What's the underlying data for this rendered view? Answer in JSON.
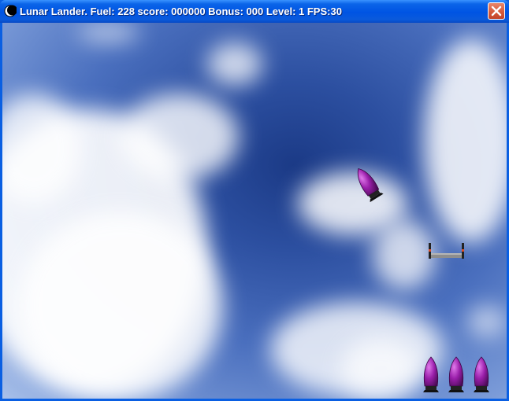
{
  "window": {
    "title": "Lunar Lander. Fuel: 228 score: 000000 Bonus: 000 Level: 1 FPS:30",
    "icon": "moon-icon",
    "close_icon": "close-icon"
  },
  "game": {
    "fuel": 228,
    "score": "000000",
    "bonus": "000",
    "level": 1,
    "fps": 30,
    "lives_remaining": 3,
    "colors": {
      "ship": "#8A1C9A",
      "sky": "#2C4FA0",
      "pad": "#9A9A9A"
    }
  }
}
